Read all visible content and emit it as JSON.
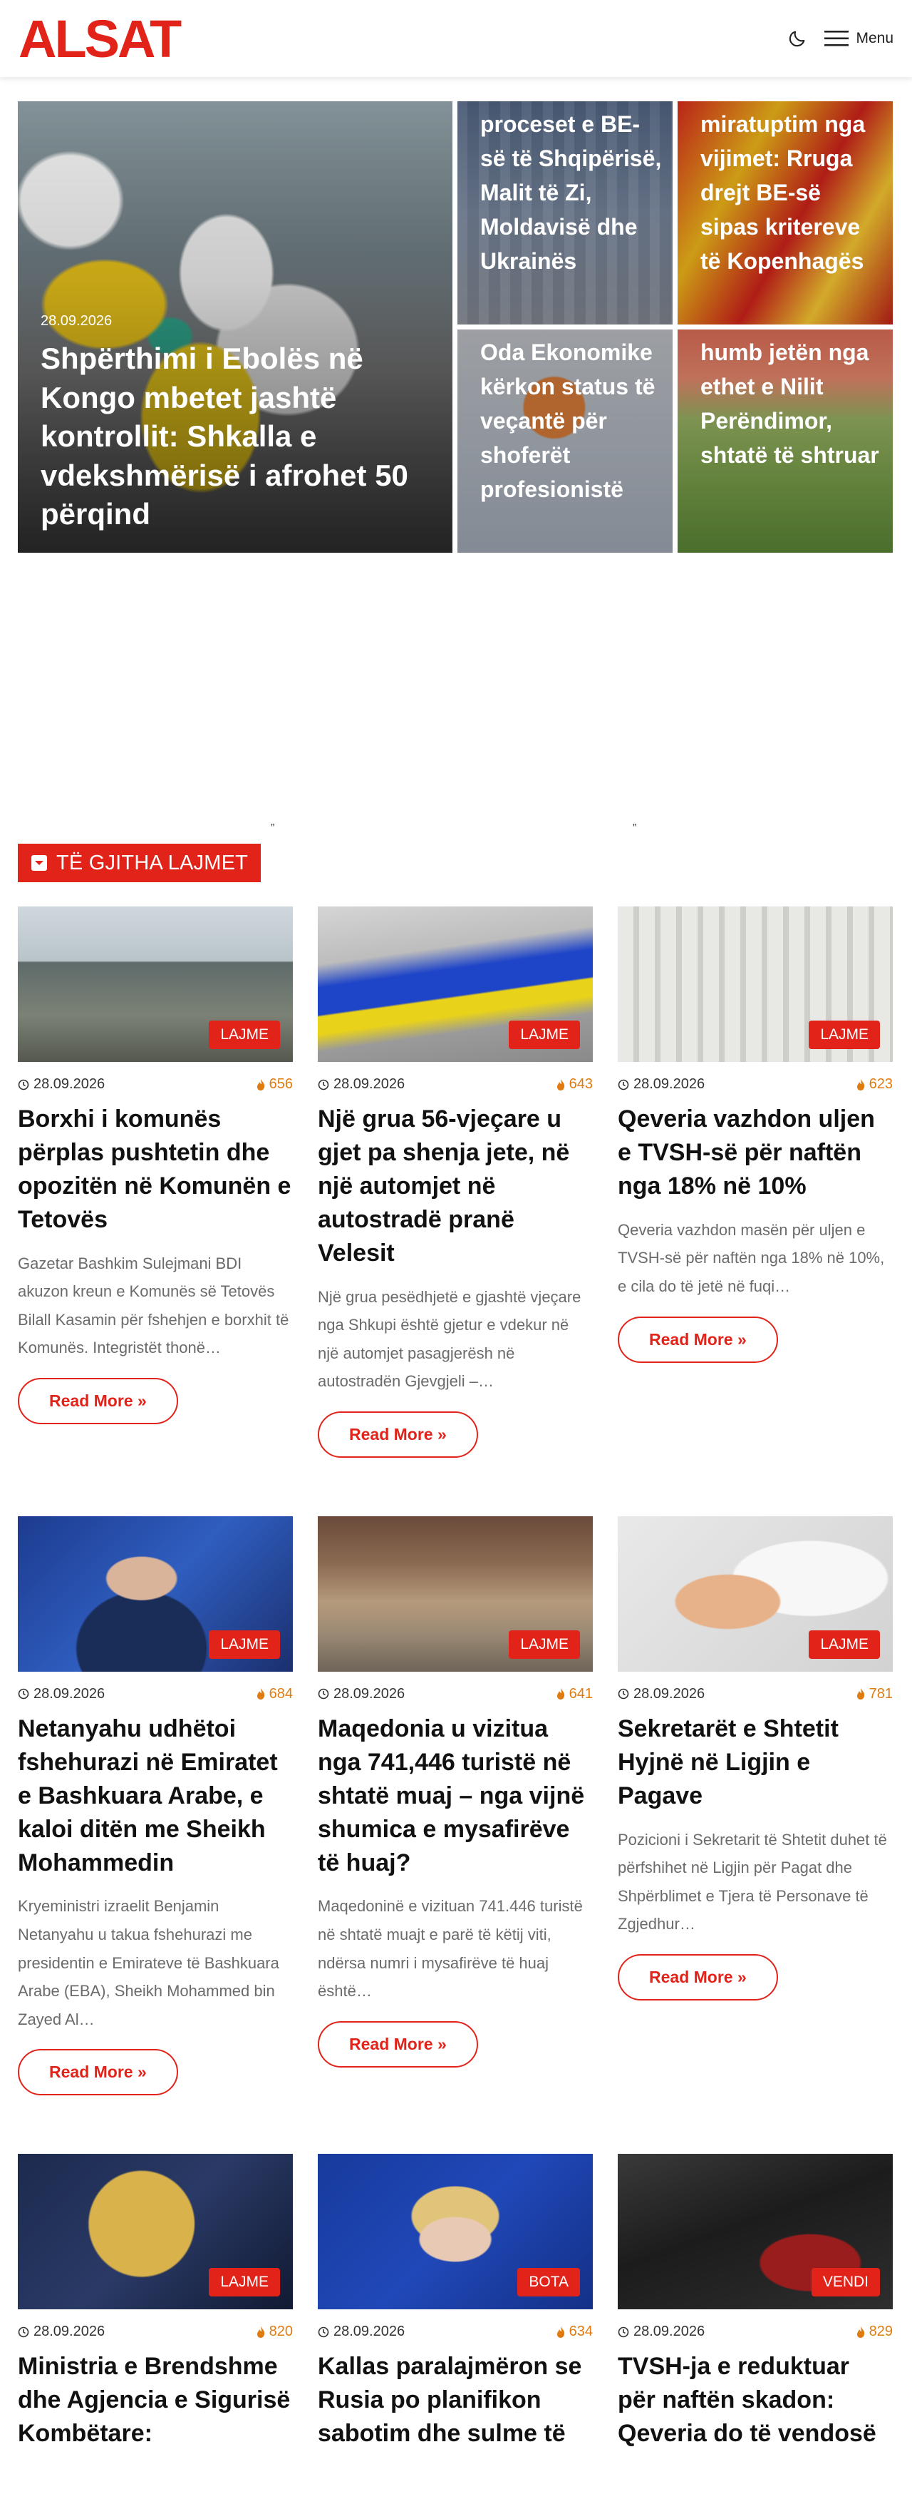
{
  "header": {
    "logo_text": "ALSAT",
    "menu_label": "Menu",
    "moon_icon": "moon-icon",
    "menu_icon": "hamburger-icon",
    "brand_color": "#e2231a"
  },
  "hero": {
    "main": {
      "date": "28.09.2026",
      "title": "Shpërthimi i Ebolës në Kongo mbetet jashtë kontrollit: Shkalla e vdekshmërisë i afrohet 50 përqind"
    },
    "side": [
      {
        "title": "proceset e BE-së të Shqipërisë, Malit të Zi, Moldavisë dhe Ukrainës"
      },
      {
        "title": "miratuptim nga vijimet: Rruga drejt BE-së sipas kritereve të Kopenhagës"
      },
      {
        "title": "Oda Ekonomike kërkon status të veçantë për shoferët profesionistë"
      },
      {
        "title": "humb jetën nga ethet e Nilit Perëndimor, shtatë të shtruar"
      }
    ]
  },
  "ad_space": {
    "quote_left": "”",
    "quote_right": "”"
  },
  "section": {
    "title": "TË GJITHA LAJMET",
    "icon": "chevron-down-box-icon"
  },
  "articles": [
    {
      "tag": "LAJME",
      "date": "28.09.2026",
      "views": "656",
      "title": "Borxhi i komunës përplas pushtetin dhe opozitën në Komunën e Tetovës",
      "excerpt": "Gazetar Bashkim Sulejmani BDI akuzon kreun e Komunës së Tetovës Bilall Kasamin për fshehjen e borxhit të Komunës. Integristët thonë…",
      "read_more": "Read More »"
    },
    {
      "tag": "LAJME",
      "date": "28.09.2026",
      "views": "643",
      "title": "Një grua 56-vjeçare u gjet pa shenja jete, në një automjet në autostradë pranë Velesit",
      "excerpt": "Një grua pesëdhjetë e gjashtë vjeçare nga Shkupi është gjetur e vdekur në një automjet pasagjerësh në autostradën Gjevgjeli –…",
      "read_more": "Read More »"
    },
    {
      "tag": "LAJME",
      "date": "28.09.2026",
      "views": "623",
      "title": "Qeveria vazhdon uljen e TVSH-së për naftën nga 18% në 10%",
      "excerpt": "Qeveria vazhdon masën për uljen e TVSH-së për naftën nga 18% në 10%, e cila do të jetë në fuqi…",
      "read_more": "Read More »"
    },
    {
      "tag": "LAJME",
      "date": "28.09.2026",
      "views": "684",
      "title": "Netanyahu udhëtoi fshehurazi në Emiratet e Bashkuara Arabe, e kaloi ditën me Sheikh Mohammedin",
      "excerpt": "Kryeministri izraelit Benjamin Netanyahu u takua fshehurazi me presidentin e Emirateve të Bashkuara Arabe (EBA), Sheikh Mohammed bin Zayed Al…",
      "read_more": "Read More »"
    },
    {
      "tag": "LAJME",
      "date": "28.09.2026",
      "views": "641",
      "title": "Maqedonia u vizitua nga 741,446 turistë në shtatë muaj – nga vijnë shumica e mysafirëve të huaj?",
      "excerpt": "Maqedoninë e vizituan 741.446 turistë në shtatë muajt e parë të këtij viti, ndërsa numri i mysafirëve të huaj është…",
      "read_more": "Read More »"
    },
    {
      "tag": "LAJME",
      "date": "28.09.2026",
      "views": "781",
      "title": "Sekretarët e Shtetit Hyjnë në Ligjin e Pagave",
      "excerpt": "Pozicioni i Sekretarit të Shtetit duhet të përfshihet në Ligjin për Pagat dhe Shpërblimet e Tjera të Personave të Zgjedhur…",
      "read_more": "Read More »"
    },
    {
      "tag": "LAJME",
      "date": "28.09.2026",
      "views": "820",
      "title": "Ministria e Brendshme dhe Agjencia e Sigurisë Kombëtare:",
      "excerpt": "",
      "read_more": ""
    },
    {
      "tag": "BOTA",
      "date": "28.09.2026",
      "views": "634",
      "title": "Kallas paralajmëron se Rusia po planifikon sabotim dhe sulme të",
      "excerpt": "",
      "read_more": ""
    },
    {
      "tag": "VENDI",
      "date": "28.09.2026",
      "views": "829",
      "title": "TVSH-ja e reduktuar për naftën skadon: Qeveria do të vendosë",
      "excerpt": "",
      "read_more": ""
    }
  ]
}
